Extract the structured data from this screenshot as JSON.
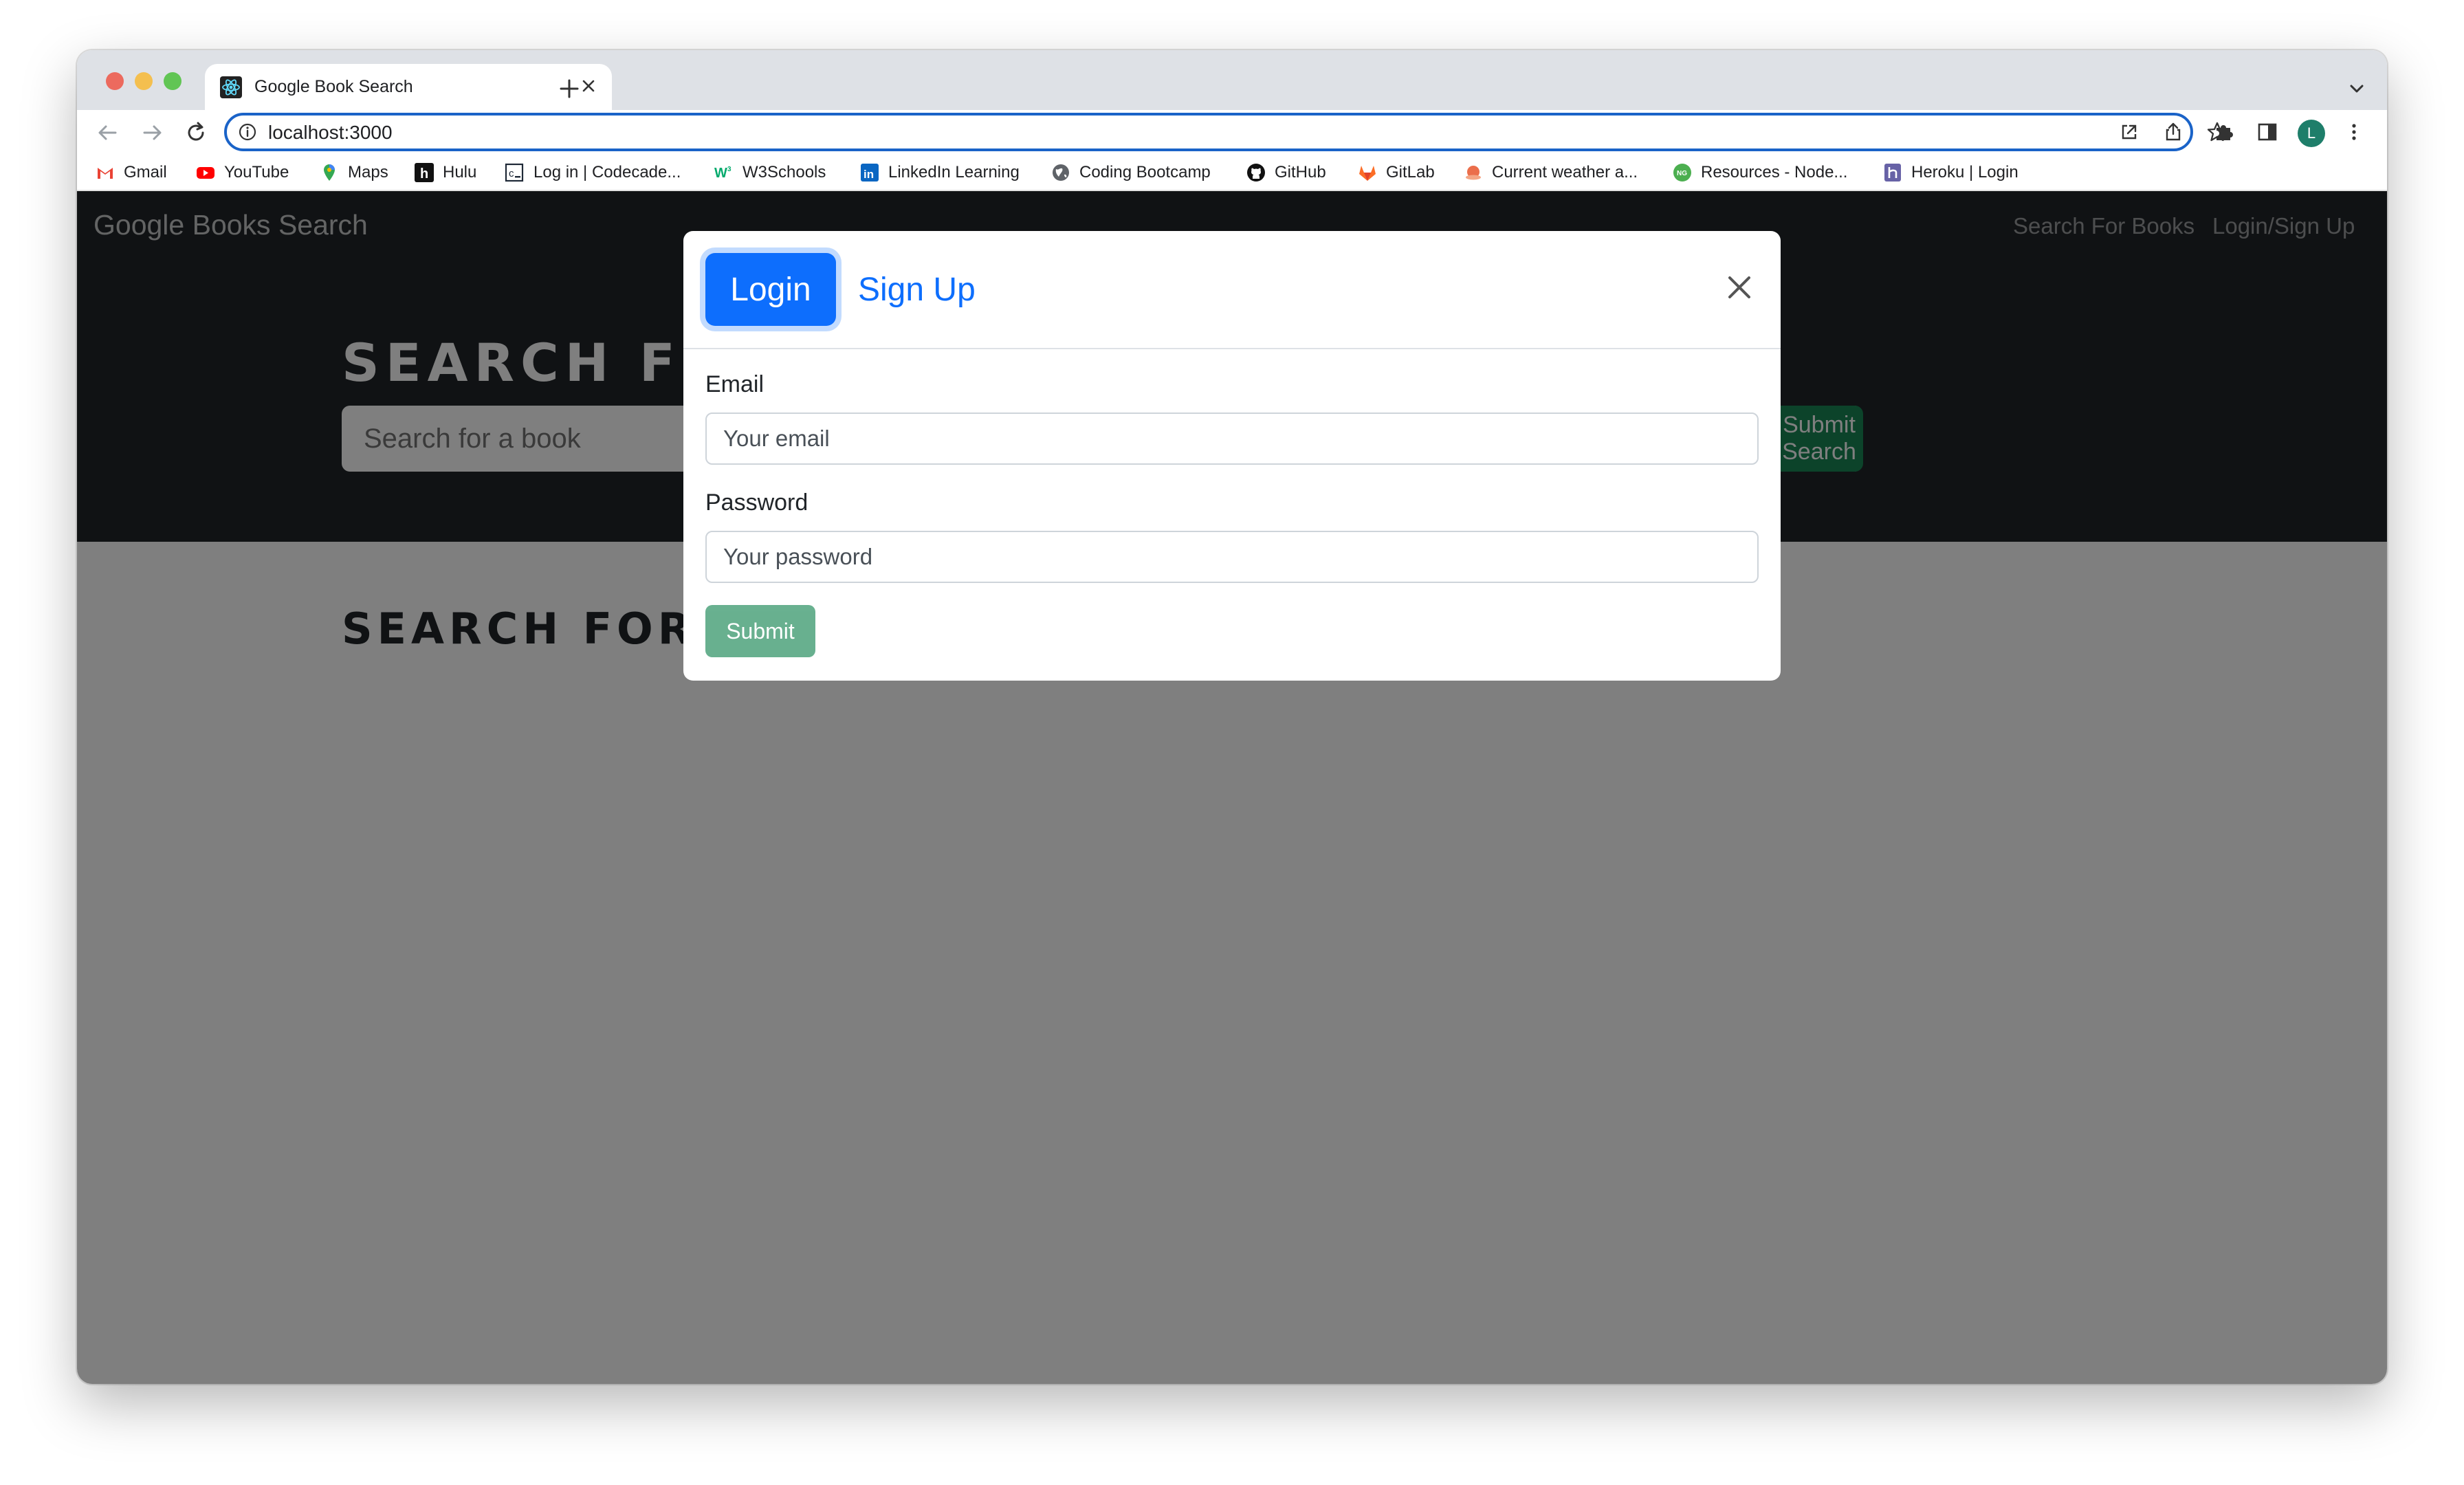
{
  "browser": {
    "tab_title": "Google Book Search",
    "url": "localhost:3000",
    "profile_initial": "L",
    "bookmarks": [
      {
        "label": "Gmail",
        "icon": "gmail-icon"
      },
      {
        "label": "YouTube",
        "icon": "youtube-icon"
      },
      {
        "label": "Maps",
        "icon": "maps-icon"
      },
      {
        "label": "Hulu",
        "icon": "hulu-icon"
      },
      {
        "label": "Log in | Codecade...",
        "icon": "codecademy-icon"
      },
      {
        "label": "W3Schools",
        "icon": "w3schools-icon"
      },
      {
        "label": "LinkedIn Learning",
        "icon": "linkedin-icon"
      },
      {
        "label": "Coding Bootcamp",
        "icon": "globe-icon"
      },
      {
        "label": "GitHub",
        "icon": "github-icon"
      },
      {
        "label": "GitLab",
        "icon": "gitlab-icon"
      },
      {
        "label": "Current weather a...",
        "icon": "weather-icon"
      },
      {
        "label": "Resources - Node...",
        "icon": "nodegit-icon"
      },
      {
        "label": "Heroku | Login",
        "icon": "heroku-icon"
      }
    ]
  },
  "app": {
    "brand": "Google Books Search",
    "nav": {
      "search": "Search For Books",
      "login": "Login/Sign Up"
    },
    "hero_title": "SEARCH FOR BOOKS!",
    "search_placeholder": "Search for a book",
    "submit_search": "Submit Search",
    "results_title": "SEARCH FOR A BOOK TO BEGIN"
  },
  "modal": {
    "tab_login": "Login",
    "tab_signup": "Sign Up",
    "email_label": "Email",
    "email_placeholder": "Your email",
    "password_label": "Password",
    "password_placeholder": "Your password",
    "submit": "Submit"
  },
  "colors": {
    "accent": "#0d6efd",
    "success": "#198754",
    "navbar": "#212529",
    "omnibox_focus": "#1a63c8"
  }
}
